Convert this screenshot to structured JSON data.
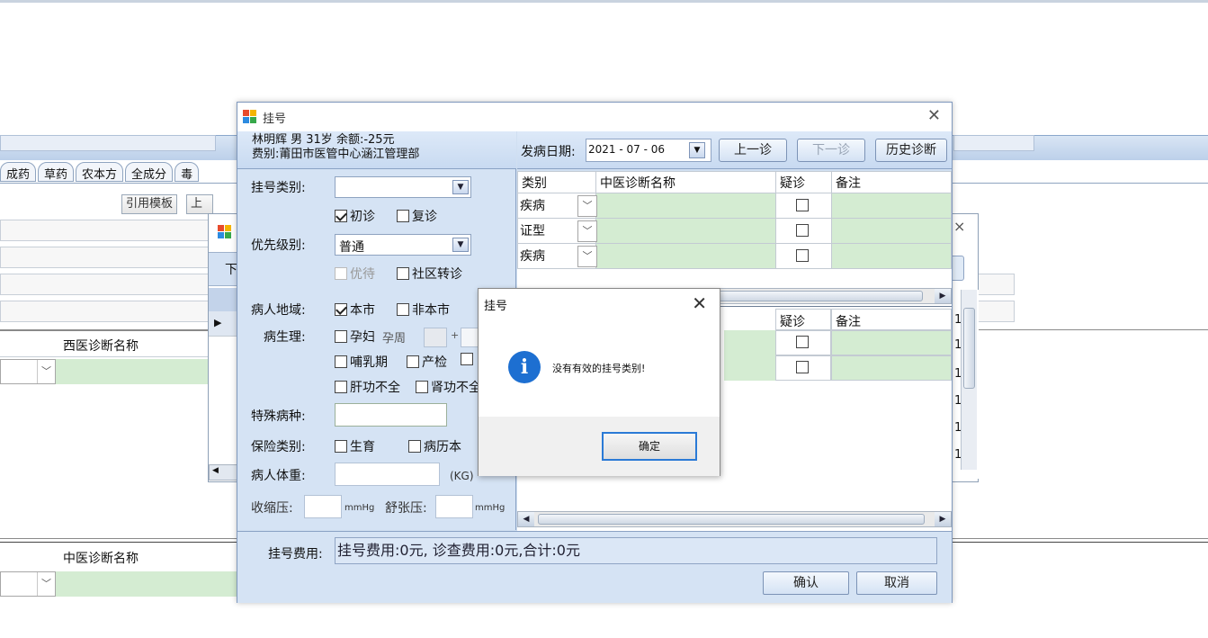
{
  "background": {
    "tabs": [
      "成药",
      "草药",
      "农本方",
      "全成分",
      "毒"
    ],
    "template_button": "引用模板",
    "prev_button": "上一诊",
    "western_dx_header": "西医诊断名称",
    "tcm_dx_header": "中医诊断名称",
    "row_marker": "▶",
    "right_digit": "1"
  },
  "dialog": {
    "title": "挂号",
    "patient_line1": "林明辉 男 31岁 余额:-25元",
    "patient_line2": "费别:莆田市医管中心涵江管理部",
    "reg_type_label": "挂号类别:",
    "reg_type_value": "",
    "first_visit_label": "初诊",
    "return_visit_label": "复诊",
    "priority_label": "优先级别:",
    "priority_value": "普通",
    "preferential_label": "优待",
    "community_label": "社区转诊",
    "region_label": "病人地域:",
    "local_label": "本市",
    "nonlocal_label": "非本市",
    "physiology_label": "病生理:",
    "pregnant_label": "孕妇",
    "gest_week_label": "孕周",
    "plus": "+",
    "lactation_label": "哺乳期",
    "prenatal_label": "产检",
    "liver_label": "肝功不全",
    "kidney_label": "肾功不全",
    "special_disease_label": "特殊病种:",
    "insurance_label": "保险类别:",
    "maternity_label": "生育",
    "record_label": "病历本",
    "weight_label": "病人体重:",
    "weight_unit": "(KG)",
    "systolic_label": "收缩压:",
    "diastolic_label": "舒张压:",
    "mmhg": "mmHg",
    "onset_label": "发病日期:",
    "onset_date": "2021 - 07 - 06",
    "prev_visit_button": "上一诊",
    "next_visit_button": "下一诊",
    "history_button": "历史诊断",
    "grid_headers": [
      "类别",
      "中医诊断名称",
      "疑诊",
      "备注"
    ],
    "grid_rows": [
      {
        "category": "疾病"
      },
      {
        "category": "证型"
      },
      {
        "category": "疾病"
      }
    ],
    "grid2_headers": [
      "疑诊",
      "备注"
    ],
    "fee_label": "挂号费用:",
    "fee_text": "挂号费用:0元, 诊查费用:0元,合计:0元",
    "confirm_button": "确认",
    "cancel_button": "取消"
  },
  "message_box": {
    "title": "挂号",
    "text": "没有有效的挂号类别!",
    "ok_button": "确定"
  }
}
